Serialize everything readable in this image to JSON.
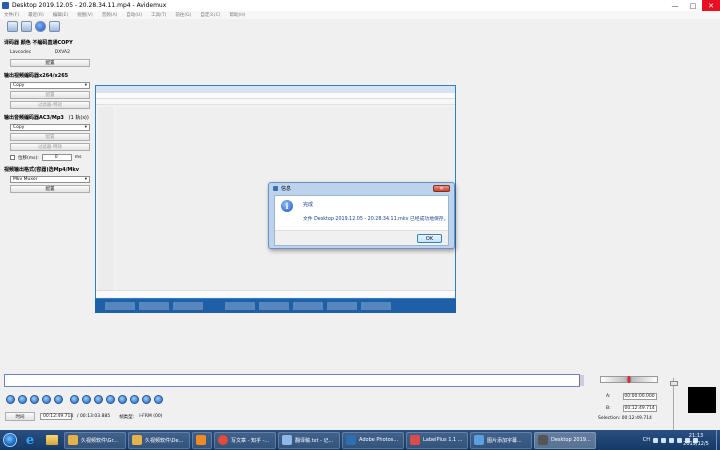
{
  "window": {
    "title": "Desktop 2019.12.05 - 20.28.34.11.mp4 - Avidemux",
    "minimize": "—",
    "maximize": "□",
    "close": "✕"
  },
  "menu": [
    "文件(F)",
    "最近(R)",
    "编辑(E)",
    "视图(V)",
    "音频(A)",
    "自动(U)",
    "工具(T)",
    "前往(G)",
    "自定义(C)",
    "帮助(H)"
  ],
  "left": {
    "decoder_title": "译码器 颜色 不编码直通COPY",
    "decoder_key": "Lavcodec",
    "decoder_val": "DXVA2",
    "config_label": "配置",
    "video_title": "输出视频编码器x264/x265",
    "video_codec": "Copy",
    "video_filter": "过滤器-特效",
    "audio_title": "输出音频编码器AC3/Mp3",
    "audio_track": "(1 轨(s))",
    "audio_codec": "Copy",
    "audio_filter": "过滤器-特效",
    "shift_label": "位移(ms):",
    "shift_value": "0",
    "shift_unit": "ms",
    "format_title": "视频输出格式(容器)选Mp4/Mkv",
    "format_value": "Mkv Muxer"
  },
  "dialog": {
    "title": "信息",
    "close": "✕",
    "heading": "完成",
    "message": "文件 Desktop 2019.12.05 - 20.28.34.11.mkv 已经成功地保存。",
    "ok": "OK"
  },
  "transport": {
    "time_button": "时间",
    "current_time": "00:12:49.714",
    "total_time": "/ 00:13:03.885",
    "frame_type_label": "帧类型:",
    "frame_type_value": "I-FRM (00)",
    "a_label": "A:",
    "a_value": "00:00:00.000",
    "b_label": "B:",
    "b_value": "00:12:49.714",
    "selection": "Selection: 00:12:49.714"
  },
  "taskbar": {
    "tasks": [
      {
        "label": "久视频软件\\Gr...",
        "icon": "folder-icon",
        "color": "#e3b24a"
      },
      {
        "label": "久视频软件\\De...",
        "icon": "folder-icon",
        "color": "#e3b24a"
      },
      {
        "label": "",
        "icon": "media-icon",
        "color": "#f08a24"
      },
      {
        "label": "写文章 - 知乎 -...",
        "icon": "chrome-icon",
        "color": "#e14b3c"
      },
      {
        "label": "翻译稿.txt - 记...",
        "icon": "notepad-icon",
        "color": "#8fb7e8"
      },
      {
        "label": "Adobe Photos...",
        "icon": "photoshop-icon",
        "color": "#2d6fb0"
      },
      {
        "label": "LabelPlus 1.1 ...",
        "icon": "labelplus-icon",
        "color": "#d94c4c"
      },
      {
        "label": "图片添加字幕...",
        "icon": "app-icon",
        "color": "#5aa0e0"
      },
      {
        "label": "Desktop 2019...",
        "icon": "avidemux-icon",
        "color": "#555555"
      }
    ],
    "tray_lang": "CH",
    "time": "21:13",
    "date": "2019/12/5"
  }
}
